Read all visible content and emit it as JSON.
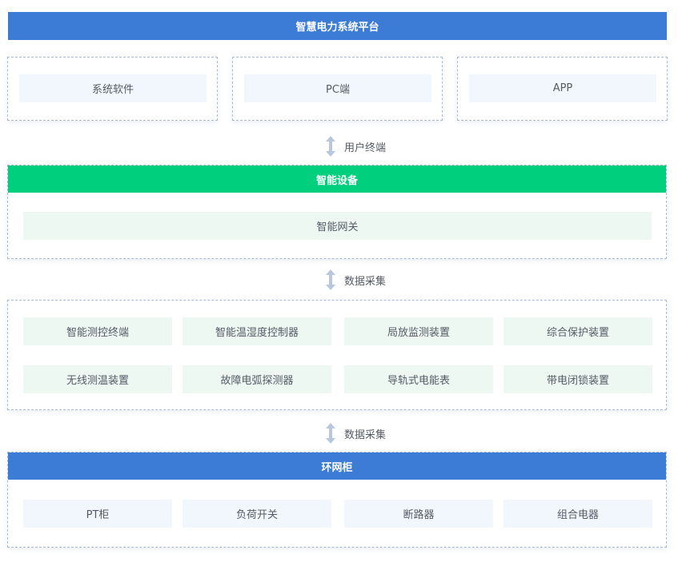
{
  "platform": {
    "title": "智慧电力系统平台",
    "cards": [
      "系统软件",
      "PC端",
      "APP"
    ]
  },
  "connectors": [
    "用户终端",
    "数据采集",
    "数据采集"
  ],
  "smart_devices": {
    "title": "智能设备",
    "gateway": "智能网关"
  },
  "acquisition": {
    "items": [
      "智能测控终端",
      "智能温湿度控制器",
      "局放监测装置",
      "综合保护装置",
      "无线测温装置",
      "故障电弧探测器",
      "导轨式电能表",
      "带电闭锁装置"
    ]
  },
  "ring_cabinet": {
    "title": "环网柜",
    "items": [
      "PT柜",
      "负荷开关",
      "断路器",
      "组合电器"
    ]
  },
  "colors": {
    "primary_blue": "#3c7bd6",
    "green": "#00d07d"
  }
}
